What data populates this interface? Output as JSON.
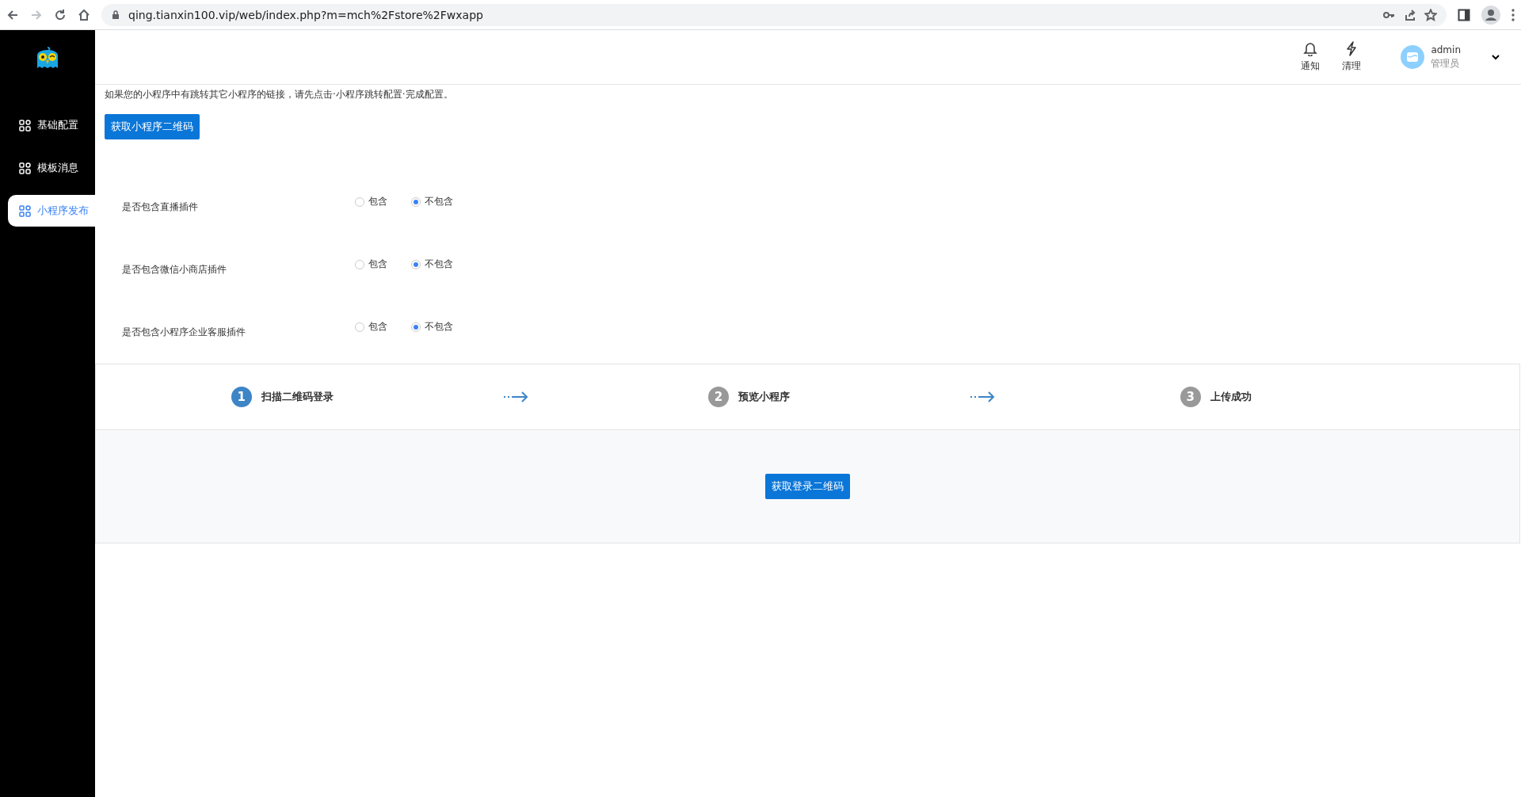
{
  "browser": {
    "url": "qing.tianxin100.vip/web/index.php?m=mch%2Fstore%2Fwxapp"
  },
  "sidebar": {
    "items": [
      {
        "label": "基础配置",
        "selected": false
      },
      {
        "label": "模板消息",
        "selected": false
      },
      {
        "label": "小程序发布",
        "selected": true
      }
    ]
  },
  "header": {
    "actions": [
      {
        "kind": "bell",
        "label": "通知"
      },
      {
        "kind": "bolt",
        "label": "清理"
      }
    ],
    "user": {
      "name": "admin",
      "role": "管理员"
    }
  },
  "notice": "如果您的小程序中有跳转其它小程序的链接，请先点击·小程序跳转配置·完成配置。",
  "qr_button": "获取小程序二维码",
  "options": [
    {
      "label": "是否包含直播插件",
      "choices": [
        {
          "label": "包含",
          "selected": false
        },
        {
          "label": "不包含",
          "selected": true
        }
      ]
    },
    {
      "label": "是否包含微信小商店插件",
      "choices": [
        {
          "label": "包含",
          "selected": false
        },
        {
          "label": "不包含",
          "selected": true
        }
      ]
    },
    {
      "label": "是否包含小程序企业客服插件",
      "choices": [
        {
          "label": "包含",
          "selected": false
        },
        {
          "label": "不包含",
          "selected": true
        }
      ]
    }
  ],
  "steps": [
    {
      "number": "1",
      "label": "扫描二维码登录",
      "active": true
    },
    {
      "number": "2",
      "label": "预览小程序",
      "active": false
    },
    {
      "number": "3",
      "label": "上传成功",
      "active": false
    }
  ],
  "login_button": "获取登录二维码"
}
